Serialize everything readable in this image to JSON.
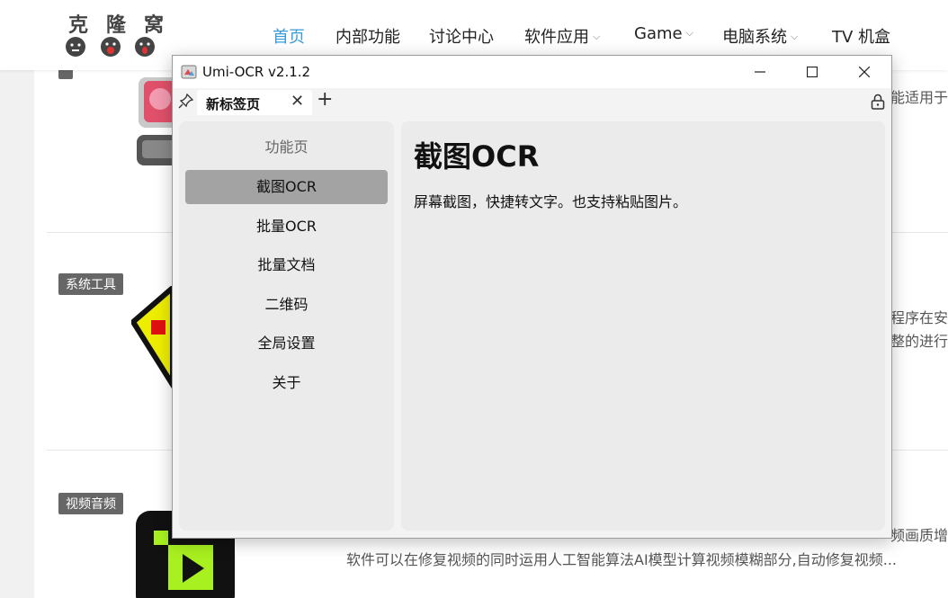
{
  "site": {
    "logo_text": "克隆窝",
    "nav": [
      {
        "label": "首页",
        "active": true,
        "dropdown": false
      },
      {
        "label": "内部功能",
        "active": false,
        "dropdown": false
      },
      {
        "label": "讨论中心",
        "active": false,
        "dropdown": false
      },
      {
        "label": "软件应用",
        "active": false,
        "dropdown": true
      },
      {
        "label": "Game",
        "active": false,
        "dropdown": true
      },
      {
        "label": "电脑系统",
        "active": false,
        "dropdown": true
      },
      {
        "label": "TV 机盒",
        "active": false,
        "dropdown": false
      }
    ],
    "tags": [
      "系统工具",
      "视频音频"
    ],
    "snippets": {
      "right_1": "能适用于",
      "right_2": "程序在安",
      "right_3": "整的进行",
      "right_4": "频画质增",
      "bottom": "软件可以在修复视频的同时运用人工智能算法AI模型计算视频模糊部分,自动修复视频..."
    },
    "accent_color": "#3a9bd8"
  },
  "window": {
    "title": "Umi-OCR v2.1.2",
    "controls": {
      "minimize": "—",
      "maximize": "☐",
      "close": "✕"
    },
    "tab": {
      "label": "新标签页",
      "close": "✕",
      "add": "+"
    },
    "icons": [
      "pin-icon",
      "lock-icon",
      "app-icon"
    ]
  },
  "sidebar": {
    "title": "功能页",
    "items": [
      {
        "label": "截图OCR",
        "active": true
      },
      {
        "label": "批量OCR",
        "active": false
      },
      {
        "label": "批量文档",
        "active": false
      },
      {
        "label": "二维码",
        "active": false
      },
      {
        "label": "全局设置",
        "active": false
      },
      {
        "label": "关于",
        "active": false
      }
    ]
  },
  "content": {
    "title": "截图OCR",
    "description": "屏幕截图，快捷转文字。也支持粘贴图片。"
  }
}
